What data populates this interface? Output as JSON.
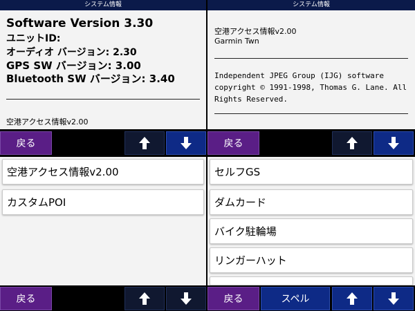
{
  "left": {
    "title": "システム情報",
    "software_version": "Software Version 3.30",
    "unit_id": "ユニットID:",
    "audio_version": "オーディオ バージョン: 2.30",
    "gps_version": "GPS SW バージョン: 3.00",
    "bluetooth_version": "Bluetooth SW バージョン: 3.40",
    "footer": "空港アクセス情報v2.00",
    "nav": {
      "back": "戻る"
    },
    "list": [
      "空港アクセス情報v2.00",
      "カスタムPOI"
    ],
    "bottom_nav": {
      "back": "戻る"
    }
  },
  "right": {
    "title": "システム情報",
    "airport_info": "空港アクセス情報v2.00",
    "garmin": "Garmin Twn",
    "jpeg_line1": "Independent JPEG Group (IJG) software",
    "jpeg_line2": "copyright © 1991-1998, Thomas G. Lane. All",
    "jpeg_line3": "Rights Reserved.",
    "nav": {
      "back": "戻る"
    },
    "list": [
      "セルフGS",
      "ダムカード",
      "バイク駐輪場",
      "リンガーハット"
    ],
    "bottom_nav": {
      "back": "戻る",
      "spell": "スペル"
    }
  },
  "icons": {
    "up": "arrow-up-icon",
    "down": "arrow-down-icon"
  },
  "colors": {
    "title_bar": "#0b1a4a",
    "back_button": "#5a1e86",
    "blue_button": "#0e2a86",
    "panel": "#f3f3f3"
  }
}
